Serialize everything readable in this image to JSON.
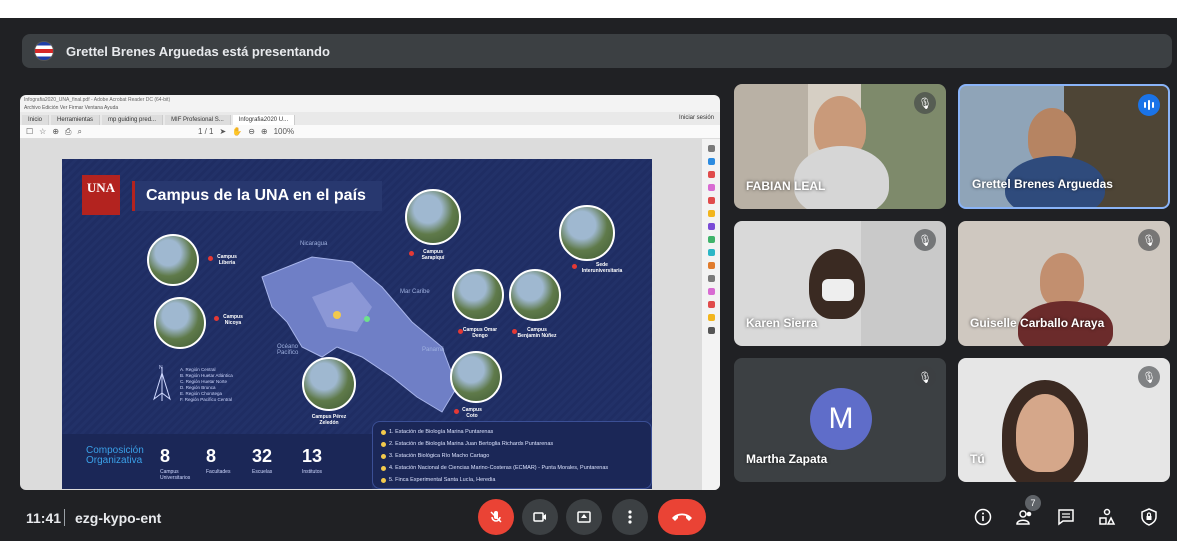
{
  "header": {
    "presenter_text": "Grettel Brenes Arguedas está presentando"
  },
  "pdf_viewer": {
    "title_bar": "Infografia2020_UNA_final.pdf - Adobe Acrobat Reader DC (64-bit)",
    "menu": "Archivo   Edición   Ver   Firmar   Ventana   Ayuda",
    "tabs": [
      "Inicio",
      "Herramientas",
      "mp guiding pred...",
      "MIF Profesional S...",
      "Infografia2020 U..."
    ],
    "tab_right": "Iniciar sesión",
    "toolbar_zoom": "100%",
    "page": "1 / 1"
  },
  "slide": {
    "logo": "UNA",
    "title": "Campus de la UNA en el país",
    "map_labels": [
      "Nicaragua",
      "Mar Caribe",
      "Océano Pacífico",
      "Panamá"
    ],
    "campuses": [
      "Campus Liberia",
      "Campus Nicoya",
      "Campus Sarapiquí",
      "Sede Interuniversitaria",
      "Campus Omar Dengo",
      "Campus Benjamín Núñez",
      "Campus Pérez Zeledón",
      "Campus Coto"
    ],
    "legend": [
      "A. Región Central",
      "B. Región Huetar Atlántica",
      "C. Región Huetar Norte",
      "D. Región Brunca",
      "E. Región Chorotega",
      "F. Región Pacífico Central"
    ],
    "composition_title": "Composición Organizativa",
    "stats": [
      {
        "num": "8",
        "label": "Campus Universitarios"
      },
      {
        "num": "8",
        "label": "Facultades"
      },
      {
        "num": "32",
        "label": "Escuelas"
      },
      {
        "num": "13",
        "label": "Institutos"
      }
    ],
    "stations": [
      "1. Estación de Biología Marina   Puntarenas",
      "2. Estación de Biología Marina Juan Bertoglia Richards   Puntarenas",
      "3. Estación Biológica   Río Macho   Cartago",
      "4. Estación Nacional de Ciencias Marino-Costeras (ECMAR) - Punta Morales, Puntarenas",
      "5. Finca Experimental Santa Lucía, Heredia"
    ]
  },
  "participants": [
    {
      "name": "FABIAN LEAL"
    },
    {
      "name": "Grettel Brenes Arguedas"
    },
    {
      "name": "Karen Sierra"
    },
    {
      "name": "Guiselle Carballo Araya"
    },
    {
      "name": "Martha Zapata",
      "initial": "M"
    },
    {
      "name": "Tú"
    }
  ],
  "bottom_bar": {
    "time": "11:41",
    "meeting_code": "ezg-kypo-ent",
    "participants_count": "7"
  }
}
